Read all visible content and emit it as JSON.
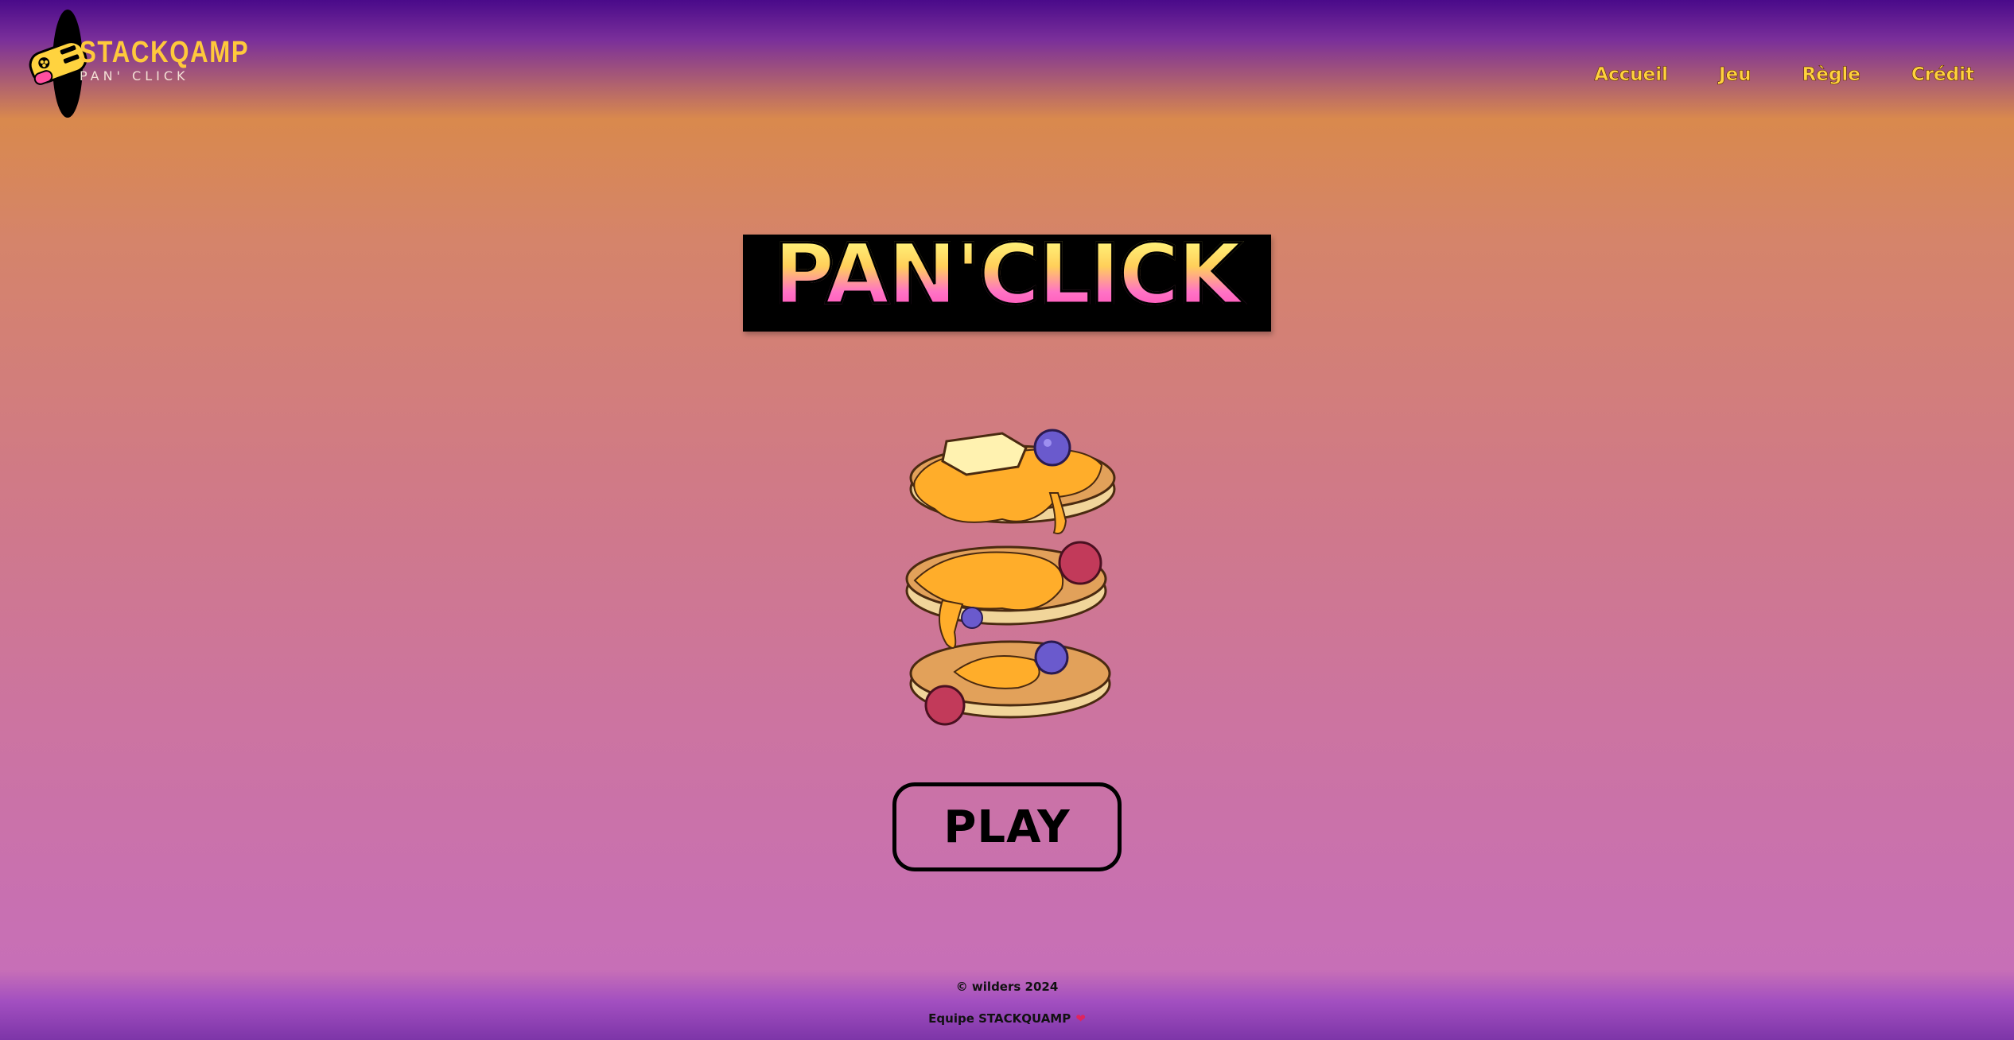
{
  "header": {
    "logo_title": "STACKQAMP",
    "logo_subtitle": "PAN' CLICK",
    "nav": [
      {
        "label": "Accueil"
      },
      {
        "label": "Jeu"
      },
      {
        "label": "Règle"
      },
      {
        "label": "Crédit"
      }
    ]
  },
  "main": {
    "title": "PAN'CLICK",
    "hero_image": "pancake-stack-illustration",
    "play_label": "PLAY"
  },
  "footer": {
    "copyright": "© wilders 2024",
    "team": "Equipe STACKQUAMP",
    "heart_icon": "heart-icon"
  },
  "colors": {
    "accent": "#ffc93b",
    "title_gradient_top": "#fff37a",
    "title_gradient_bottom": "#ff4fb9",
    "background_top": "#4a0a8a",
    "background_bottom": "#7d35a8"
  }
}
